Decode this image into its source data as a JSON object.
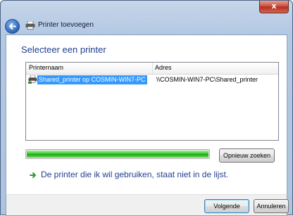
{
  "window": {
    "title": "Printer toevoegen",
    "close_glyph": "x"
  },
  "main": {
    "heading": "Selecteer een printer",
    "columns": [
      "Printernaam",
      "Adres"
    ],
    "printers": [
      {
        "name": "Shared_printer op COSMIN-WIN7-PC",
        "address": "\\\\COSMIN-WIN7-PC\\Shared_printer",
        "selected": true
      }
    ],
    "search_progress": 1.0,
    "search_again_label": "Opnieuw zoeken",
    "not_listed_link": "De printer die ik wil gebruiken, staat niet in de lijst."
  },
  "footer": {
    "next_label": "Volgende",
    "cancel_label": "Annuleren"
  },
  "icons": [
    "back-arrow-icon",
    "printer-icon",
    "close-icon",
    "green-arrow-icon"
  ],
  "colors": {
    "accent": "#1e3e91",
    "selection": "#3399ff",
    "progress": "#37c728"
  }
}
